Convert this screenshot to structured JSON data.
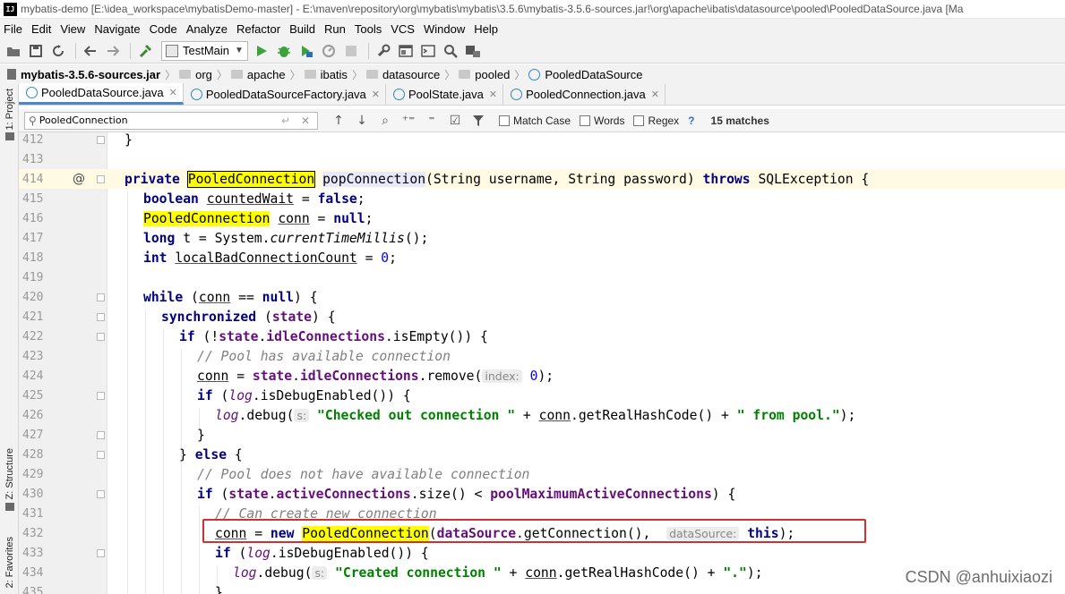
{
  "window": {
    "title": "mybatis-demo [E:\\idea_workspace\\mybatisDemo-master] - E:\\maven\\repository\\org\\mybatis\\mybatis\\3.5.6\\mybatis-3.5.6-sources.jar!\\org\\apache\\ibatis\\datasource\\pooled\\PooledDataSource.java [Ma",
    "app_icon": "IJ"
  },
  "menu": [
    "File",
    "Edit",
    "View",
    "Navigate",
    "Code",
    "Analyze",
    "Refactor",
    "Build",
    "Run",
    "Tools",
    "VCS",
    "Window",
    "Help"
  ],
  "toolbar": {
    "run_config": "TestMain",
    "icons": [
      "open-folder-icon",
      "save-icon",
      "sync-icon",
      "back-arrow-icon",
      "forward-arrow-icon",
      "build-hammer-icon",
      "run-config-dropdown",
      "run-icon",
      "debug-icon",
      "coverage-icon",
      "profile-icon",
      "stop-icon",
      "settings-icon",
      "project-structure-icon",
      "terminal-icon",
      "search-icon",
      "tasks-icon"
    ]
  },
  "breadcrumb": [
    "mybatis-3.5.6-sources.jar",
    "org",
    "apache",
    "ibatis",
    "datasource",
    "pooled",
    "PooledDataSource"
  ],
  "left_tools": {
    "project": "1: Project",
    "structure": "Z: Structure",
    "favorites": "2: Favorites"
  },
  "tabs": [
    {
      "label": "PooledDataSource.java",
      "active": true
    },
    {
      "label": "PooledDataSourceFactory.java",
      "active": false
    },
    {
      "label": "PoolState.java",
      "active": false
    },
    {
      "label": "PooledConnection.java",
      "active": false
    }
  ],
  "search": {
    "query": "PooledConnection",
    "match_case": "Match Case",
    "words": "Words",
    "regex": "Regex",
    "help": "?",
    "matches": "15 matches"
  },
  "editor": {
    "line_numbers": [
      "412",
      "413",
      "414",
      "415",
      "416",
      "417",
      "418",
      "419",
      "420",
      "421",
      "422",
      "423",
      "424",
      "425",
      "426",
      "427",
      "428",
      "429",
      "430",
      "431",
      "432",
      "433",
      "434",
      "435"
    ],
    "gutter_marker": "@",
    "tokens": {
      "close_brace": "}",
      "private": "private",
      "PooledConnection": "PooledConnection",
      "popConnection": "popConnection",
      "sig_params": "(String username, String password) ",
      "throws": "throws",
      "sig_tail": " SQLException {",
      "boolean": "boolean",
      "countedWait": "countedWait",
      "eq": " = ",
      "false": "false",
      "semi": ";",
      "conn": "conn",
      "null": "null",
      "long": "long",
      "t_assign": " t = System.",
      "currentTimeMillis": "currentTimeMillis",
      "call_end": "();",
      "int": "int",
      "localBadConnectionCount": "localBadConnectionCount",
      "zero": "0",
      "while": "while",
      "while_open": " (",
      "eqeq": " == ",
      "while_close": ") {",
      "synchronized": "synchronized",
      "sync_open": " (",
      "state": "state",
      "sync_close": ") {",
      "if": "if",
      "if_not": " (!",
      "dot": ".",
      "idleConnections": "idleConnections",
      "isEmpty_call": ".isEmpty()) {",
      "comment_pool_has": "// Pool has available connection",
      "remove_open": ".remove(",
      "hint_index": "index:",
      "remove_close": ");",
      "if_open": " (",
      "log": "log",
      "isDebugEnabled": ".isDebugEnabled()) {",
      "debug_open": ".debug(",
      "hint_s": "s:",
      "str_checked_out": "\"Checked out connection \"",
      "plus": " + ",
      "getRealHashCode": ".getRealHashCode()",
      "str_from_pool": "\" from pool.\"",
      "close_paren_semi": ");",
      "else": "else",
      "else_brace": "} ",
      "open_brace": " {",
      "comment_pool_not": "// Pool does not have available connection",
      "activeConnections": "activeConnections",
      "size_lt": ".size() < ",
      "poolMaximumActiveConnections": "poolMaximumActiveConnections",
      "close_paren_brace": ") {",
      "comment_can_create": "// Can create new connection",
      "new": "new",
      "dataSource": "dataSource",
      "getConnection": ".getConnection(),",
      "hint_datasource": "dataSource:",
      "this": "this",
      "str_created": "\"Created connection \"",
      "str_dot": "\".\""
    }
  },
  "watermark": "CSDN @anhuixiaozi",
  "colors": {
    "keyword": "#000080",
    "string": "#008000",
    "number": "#0000ff",
    "comment": "#808080",
    "field": "#660e7a",
    "search_highlight": "#ffff00",
    "current_line": "#fffae3",
    "annotation_box": "#d32f2f"
  }
}
